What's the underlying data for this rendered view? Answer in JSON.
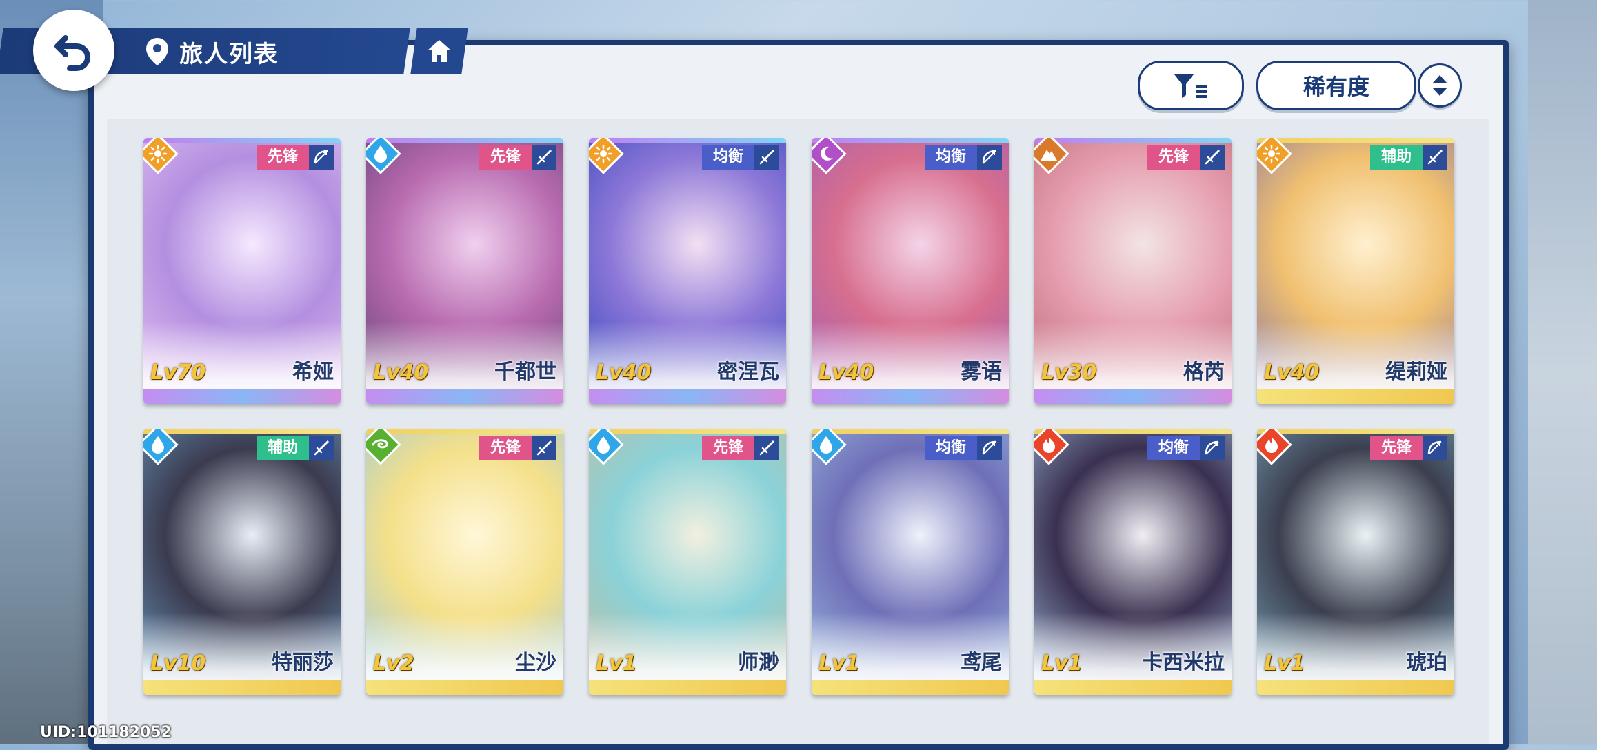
{
  "header": {
    "title": "旅人列表"
  },
  "toolbar": {
    "sort_label": "稀有度"
  },
  "footer": {
    "uid": "UID:101182052"
  },
  "colors": {
    "navy": "#1b3a78",
    "vanguard": "#e0548a",
    "balance": "#4a5ec9",
    "support": "#2fbf8c"
  },
  "cards": [
    {
      "name": "希娅",
      "level": "Lv70",
      "role": "先锋",
      "element": "sun",
      "weapon": "bow",
      "rarity": "purple"
    },
    {
      "name": "千都世",
      "level": "Lv40",
      "role": "先锋",
      "element": "water",
      "weapon": "sword",
      "rarity": "purple"
    },
    {
      "name": "密涅瓦",
      "level": "Lv40",
      "role": "均衡",
      "element": "sun",
      "weapon": "sword",
      "rarity": "purple"
    },
    {
      "name": "雾语",
      "level": "Lv40",
      "role": "均衡",
      "element": "moon",
      "weapon": "bow",
      "rarity": "purple"
    },
    {
      "name": "格芮",
      "level": "Lv30",
      "role": "先锋",
      "element": "mountain",
      "weapon": "sword",
      "rarity": "purple"
    },
    {
      "name": "缇莉娅",
      "level": "Lv40",
      "role": "辅助",
      "element": "sun",
      "weapon": "sword",
      "rarity": "gold"
    },
    {
      "name": "特丽莎",
      "level": "Lv10",
      "role": "辅助",
      "element": "water",
      "weapon": "sword",
      "rarity": "gold"
    },
    {
      "name": "尘沙",
      "level": "Lv2",
      "role": "先锋",
      "element": "wind",
      "weapon": "sword",
      "rarity": "gold"
    },
    {
      "name": "师渺",
      "level": "Lv1",
      "role": "先锋",
      "element": "water",
      "weapon": "sword",
      "rarity": "gold"
    },
    {
      "name": "鸢尾",
      "level": "Lv1",
      "role": "均衡",
      "element": "water",
      "weapon": "bow",
      "rarity": "gold"
    },
    {
      "name": "卡西米拉",
      "level": "Lv1",
      "role": "均衡",
      "element": "fire",
      "weapon": "bow",
      "rarity": "gold"
    },
    {
      "name": "琥珀",
      "level": "Lv1",
      "role": "先锋",
      "element": "fire",
      "weapon": "bow",
      "rarity": "gold"
    }
  ]
}
